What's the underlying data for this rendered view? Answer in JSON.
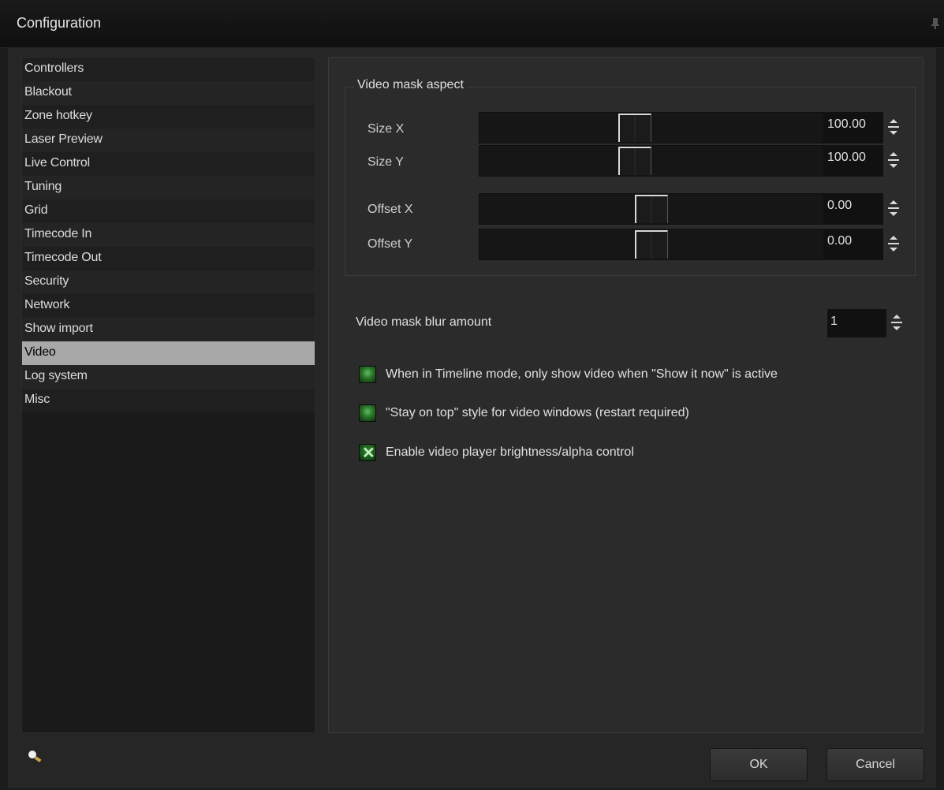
{
  "window": {
    "title": "Configuration"
  },
  "sidebar": {
    "items": [
      {
        "label": "Controllers"
      },
      {
        "label": "Blackout"
      },
      {
        "label": "Zone hotkey"
      },
      {
        "label": "Laser Preview"
      },
      {
        "label": "Live Control"
      },
      {
        "label": "Tuning"
      },
      {
        "label": "Grid"
      },
      {
        "label": "Timecode In"
      },
      {
        "label": "Timecode Out"
      },
      {
        "label": "Security"
      },
      {
        "label": "Network"
      },
      {
        "label": "Show import"
      },
      {
        "label": "Video"
      },
      {
        "label": "Log system"
      },
      {
        "label": "Misc"
      }
    ],
    "selected": "Video"
  },
  "video": {
    "group_title": "Video mask aspect",
    "size_x": {
      "label": "Size X",
      "value": "100.00"
    },
    "size_y": {
      "label": "Size Y",
      "value": "100.00"
    },
    "offset_x": {
      "label": "Offset X",
      "value": "0.00"
    },
    "offset_y": {
      "label": "Offset Y",
      "value": "0.00"
    },
    "blur": {
      "label": "Video mask blur amount",
      "value": "1"
    },
    "options": [
      {
        "label": "When in Timeline mode, only show video when \"Show it now\" is active",
        "checked": false
      },
      {
        "label": "\"Stay on top\" style for video windows (restart required)",
        "checked": false
      },
      {
        "label": "Enable video player brightness/alpha control",
        "checked": true
      }
    ]
  },
  "footer": {
    "ok_label": "OK",
    "cancel_label": "Cancel"
  }
}
